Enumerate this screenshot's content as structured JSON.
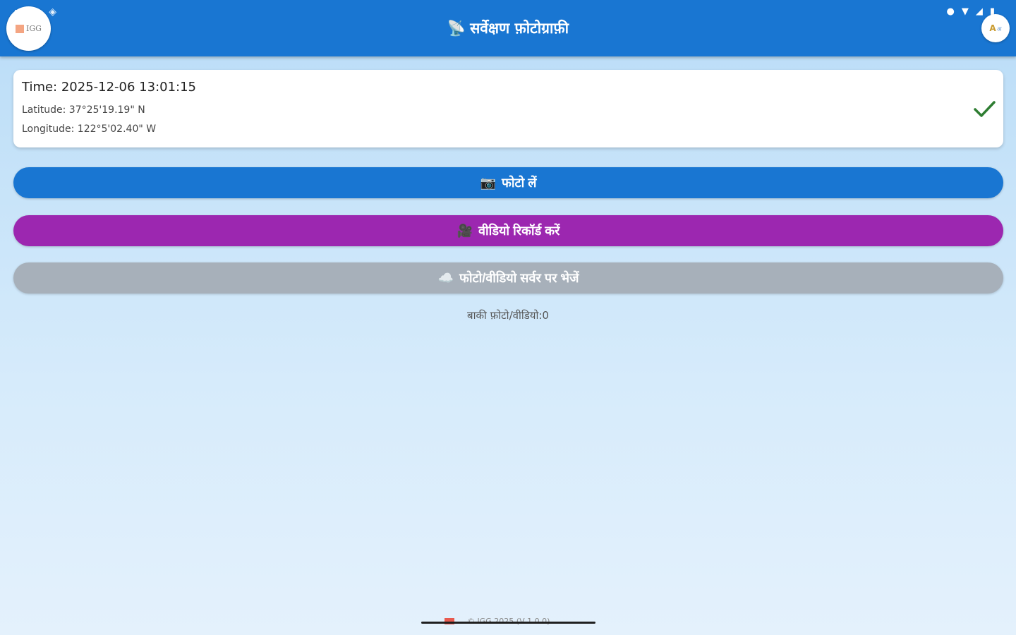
{
  "app": {
    "title": "सर्वेक्षण फ़ोटोग्राफ़ी",
    "title_emoji": "📡",
    "logo_text": "IGG"
  },
  "status_bar": {
    "left_icons": [
      "notification-icon",
      "settings-icon",
      "location-icon"
    ],
    "right_icons": [
      "location-pin-icon",
      "wifi-icon",
      "signal-icon",
      "battery-icon"
    ]
  },
  "location_card": {
    "time": "Time: 2025-12-06 13:01:15",
    "latitude": "Latitude: 37°25'19.19\" N",
    "longitude": "Longitude: 122°5'02.40\" W",
    "status_color": "#2e7d32"
  },
  "buttons": {
    "photo": {
      "emoji": "📷",
      "label": "फोटो लें",
      "color": "#1976d2"
    },
    "video": {
      "emoji": "🎥",
      "label": "वीडियो रिकॉर्ड करें",
      "color": "#9c27b0"
    },
    "upload": {
      "emoji": "☁️",
      "label": "फोटो/वीडियो सर्वर पर भेजें",
      "color": "#a7b0ba"
    }
  },
  "remaining": "बाकी फ़ोटो/वीडियो:0",
  "footer": {
    "text": "© IGG 2025 (V 1.0.0)"
  }
}
